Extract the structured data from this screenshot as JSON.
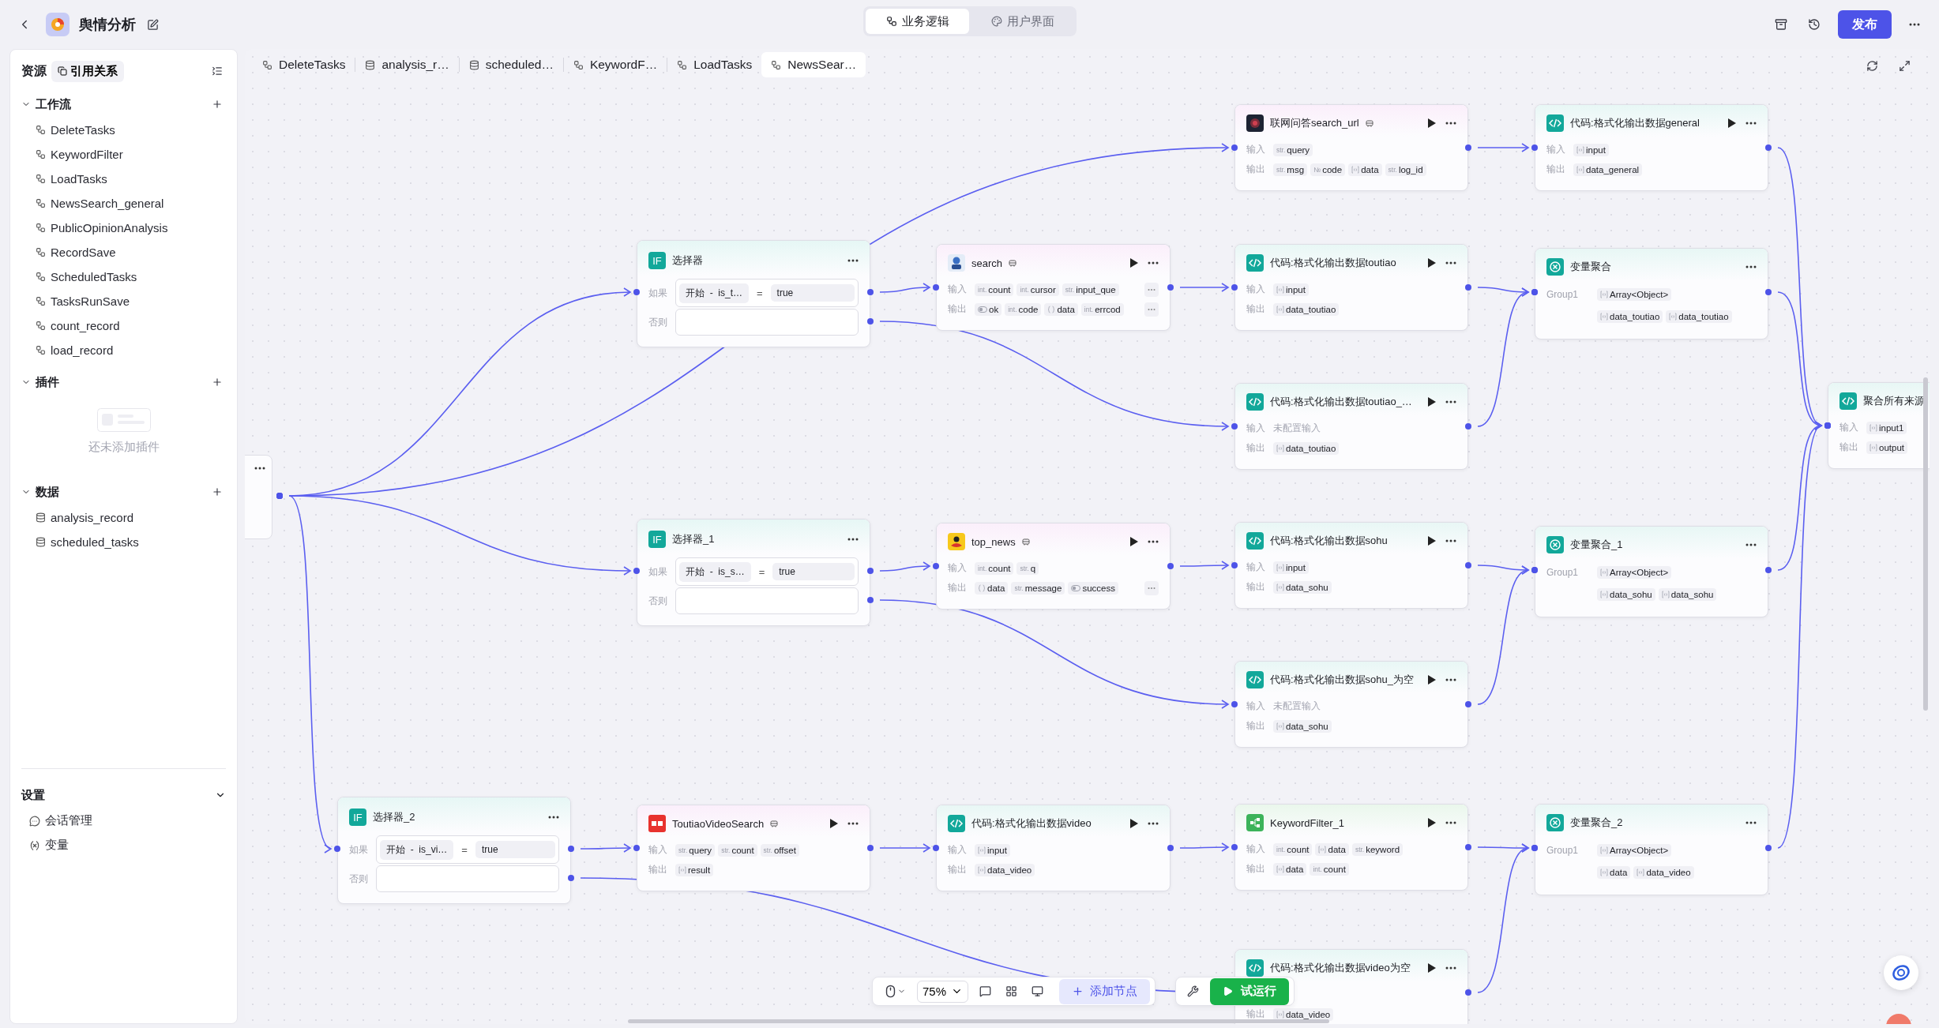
{
  "header": {
    "title": "舆情分析",
    "view_tabs": [
      {
        "label": "业务逻辑",
        "kind": "logic",
        "selected": true
      },
      {
        "label": "用户界面",
        "kind": "ui",
        "selected": false
      }
    ],
    "publish_button": "发布"
  },
  "sidebar": {
    "title": "资源",
    "reference_button": "引用关系",
    "sections": [
      {
        "title": "工作流",
        "expanded": true,
        "items": [
          {
            "label": "DeleteTasks",
            "kind": "workflow"
          },
          {
            "label": "KeywordFilter",
            "kind": "workflow"
          },
          {
            "label": "LoadTasks",
            "kind": "workflow"
          },
          {
            "label": "NewsSearch_general",
            "kind": "workflow"
          },
          {
            "label": "PublicOpinionAnalysis",
            "kind": "workflow"
          },
          {
            "label": "RecordSave",
            "kind": "workflow"
          },
          {
            "label": "ScheduledTasks",
            "kind": "workflow"
          },
          {
            "label": "TasksRunSave",
            "kind": "workflow"
          },
          {
            "label": "count_record",
            "kind": "workflow"
          },
          {
            "label": "load_record",
            "kind": "workflow"
          }
        ]
      },
      {
        "title": "插件",
        "expanded": true,
        "empty_text": "还未添加插件"
      },
      {
        "title": "数据",
        "expanded": true,
        "items": [
          {
            "label": "analysis_record",
            "kind": "database"
          },
          {
            "label": "scheduled_tasks",
            "kind": "database"
          }
        ]
      }
    ],
    "settings": {
      "title": "设置",
      "expanded": true,
      "items": [
        {
          "label": "会话管理",
          "kind": "session"
        },
        {
          "label": "变量",
          "kind": "variable"
        }
      ]
    }
  },
  "canvas_tabs": [
    {
      "label": "DeleteTasks",
      "kind": "workflow",
      "selected": false
    },
    {
      "label": "analysis_r…",
      "kind": "database",
      "selected": false
    },
    {
      "label": "scheduled…",
      "kind": "database",
      "selected": false
    },
    {
      "label": "KeywordF…",
      "kind": "workflow",
      "selected": false
    },
    {
      "label": "LoadTasks",
      "kind": "workflow",
      "selected": false
    },
    {
      "label": "NewsSear…",
      "kind": "workflow",
      "selected": true
    }
  ],
  "nodes": [
    {
      "kind": "plugin",
      "title": "联网问答search_url",
      "input_label": "输入",
      "output_label": "输出",
      "inputs": [
        {
          "kind": "text",
          "type": "str.",
          "name": "query"
        }
      ],
      "outputs": [
        {
          "kind": "text",
          "type": "str.",
          "name": "msg"
        },
        {
          "kind": "text",
          "type": "№",
          "name": "code"
        },
        {
          "kind": "array",
          "name": "data"
        },
        {
          "kind": "text",
          "type": "str.",
          "name": "log_id"
        }
      ]
    },
    {
      "kind": "code",
      "title": "代码:格式化输出数据general",
      "input_label": "输入",
      "output_label": "输出",
      "inputs": [
        {
          "kind": "array",
          "name": "input"
        }
      ],
      "outputs": [
        {
          "kind": "array",
          "name": "data_general"
        }
      ]
    },
    {
      "kind": "condition",
      "badge": "IF",
      "title": "选择器",
      "if_label": "如果",
      "else_label": "否则",
      "left": "开始  -  is_t…",
      "operator": "=",
      "value": "true"
    },
    {
      "kind": "plugin",
      "title": "search",
      "input_label": "输入",
      "output_label": "输出",
      "inputs": [
        {
          "kind": "text",
          "type": "int.",
          "name": "count"
        },
        {
          "kind": "text",
          "type": "int.",
          "name": "cursor"
        },
        {
          "kind": "text",
          "type": "str.",
          "name": "input_que"
        }
      ],
      "inputs_more": true,
      "outputs": [
        {
          "kind": "bool",
          "name": "ok"
        },
        {
          "kind": "text",
          "type": "int.",
          "name": "code"
        },
        {
          "kind": "object",
          "name": "data"
        },
        {
          "kind": "text",
          "type": "int.",
          "name": "errcod"
        }
      ],
      "outputs_more": true
    },
    {
      "kind": "code",
      "title": "代码:格式化输出数据toutiao",
      "input_label": "输入",
      "output_label": "输出",
      "inputs": [
        {
          "kind": "array",
          "name": "input"
        }
      ],
      "outputs": [
        {
          "kind": "array",
          "name": "data_toutiao"
        }
      ]
    },
    {
      "kind": "aggregate",
      "title": "变量聚合",
      "group_label": "Group1",
      "group_type": "Array<Object>",
      "items": [
        {
          "kind": "array",
          "name": "data_toutiao"
        },
        {
          "kind": "array",
          "name": "data_toutiao"
        }
      ]
    },
    {
      "kind": "code",
      "title": "代码:格式化输出数据toutiao_…",
      "input_label": "输入",
      "output_label": "输出",
      "inputs_placeholder": "未配置输入",
      "outputs": [
        {
          "kind": "array",
          "name": "data_toutiao"
        }
      ]
    },
    {
      "kind": "code",
      "title": "聚合所有来源",
      "input_label": "输入",
      "output_label": "输出",
      "inputs": [
        {
          "kind": "array",
          "name": "input1"
        }
      ],
      "outputs": [
        {
          "kind": "array",
          "name": "output"
        }
      ]
    },
    {
      "kind": "condition",
      "badge": "IF",
      "title": "选择器_1",
      "if_label": "如果",
      "else_label": "否则",
      "left": "开始  -  is_s…",
      "operator": "=",
      "value": "true"
    },
    {
      "kind": "plugin",
      "title": "top_news",
      "input_label": "输入",
      "output_label": "输出",
      "inputs": [
        {
          "kind": "text",
          "type": "int.",
          "name": "count"
        },
        {
          "kind": "text",
          "type": "str.",
          "name": "q"
        }
      ],
      "outputs": [
        {
          "kind": "object",
          "name": "data"
        },
        {
          "kind": "text",
          "type": "str.",
          "name": "message"
        },
        {
          "kind": "bool",
          "name": "success"
        }
      ],
      "outputs_more": true
    },
    {
      "kind": "code",
      "title": "代码:格式化输出数据sohu",
      "input_label": "输入",
      "output_label": "输出",
      "inputs": [
        {
          "kind": "array",
          "name": "input"
        }
      ],
      "outputs": [
        {
          "kind": "array",
          "name": "data_sohu"
        }
      ]
    },
    {
      "kind": "aggregate",
      "title": "变量聚合_1",
      "group_label": "Group1",
      "group_type": "Array<Object>",
      "items": [
        {
          "kind": "array",
          "name": "data_sohu"
        },
        {
          "kind": "array",
          "name": "data_sohu"
        }
      ]
    },
    {
      "kind": "code",
      "title": "代码:格式化输出数据sohu_为空",
      "input_label": "输入",
      "output_label": "输出",
      "inputs_placeholder": "未配置输入",
      "outputs": [
        {
          "kind": "array",
          "name": "data_sohu"
        }
      ]
    },
    {
      "kind": "condition",
      "badge": "IF",
      "title": "选择器_2",
      "if_label": "如果",
      "else_label": "否则",
      "left": "开始  -  is_vi…",
      "operator": "=",
      "value": "true"
    },
    {
      "kind": "plugin",
      "title": "ToutiaoVideoSearch",
      "input_label": "输入",
      "output_label": "输出",
      "inputs": [
        {
          "kind": "text",
          "type": "str.",
          "name": "query"
        },
        {
          "kind": "text",
          "type": "str.",
          "name": "count"
        },
        {
          "kind": "text",
          "type": "str.",
          "name": "offset"
        }
      ],
      "outputs": [
        {
          "kind": "array",
          "name": "result"
        }
      ]
    },
    {
      "kind": "code",
      "title": "代码:格式化输出数据video",
      "input_label": "输入",
      "output_label": "输出",
      "inputs": [
        {
          "kind": "array",
          "name": "input"
        }
      ],
      "outputs": [
        {
          "kind": "array",
          "name": "data_video"
        }
      ]
    },
    {
      "kind": "workflow",
      "title": "KeywordFilter_1",
      "input_label": "输入",
      "output_label": "输出",
      "inputs": [
        {
          "kind": "text",
          "type": "int.",
          "name": "count"
        },
        {
          "kind": "array",
          "name": "data"
        },
        {
          "kind": "text",
          "type": "str.",
          "name": "keyword"
        }
      ],
      "outputs": [
        {
          "kind": "array",
          "name": "data"
        },
        {
          "kind": "text",
          "type": "int.",
          "name": "count"
        }
      ]
    },
    {
      "kind": "aggregate",
      "title": "变量聚合_2",
      "group_label": "Group1",
      "group_type": "Array<Object>",
      "items": [
        {
          "kind": "array",
          "name": "data"
        },
        {
          "kind": "array",
          "name": "data_video"
        }
      ]
    },
    {
      "kind": "code",
      "title": "代码:格式化输出数据video为空",
      "output_label": "输出",
      "outputs": [
        {
          "kind": "array",
          "name": "data_video"
        }
      ]
    }
  ],
  "toolbar": {
    "zoom": "75%",
    "add_node": "添加节点",
    "test_run": "试运行"
  }
}
